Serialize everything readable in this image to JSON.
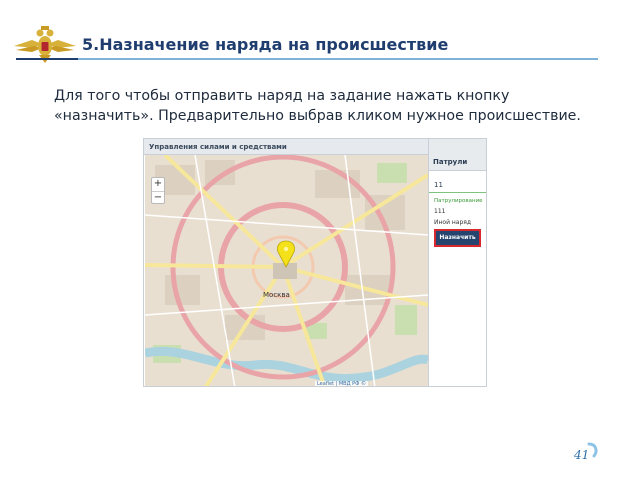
{
  "slide": {
    "title": "5.Назначение наряда на происшествие",
    "instruction_line1": "Для того чтобы отправить наряд на задание нажать кнопку",
    "instruction_line2": "«назначить». Предварительно выбрав кликом нужное происшествие.",
    "page_number": "41"
  },
  "app": {
    "header_title": "Управления силами и средствами",
    "map": {
      "zoom_in": "+",
      "zoom_out": "−",
      "city_label": "Москва",
      "attribution": "Leaflet | МВД РФ ©"
    },
    "panel": {
      "title": "Патрули",
      "patrol_id": "11",
      "status": "Патрулирование",
      "unit_number": "111",
      "task": "Иной наряд",
      "assign_button": "Назначить"
    }
  },
  "colors": {
    "title": "#1f3d6e",
    "accent_line": "#7fb2d9",
    "button_bg": "#25456e",
    "button_border": "#d9272e",
    "marker": "#f5e11a"
  },
  "icons": {
    "emblem": "double-headed-eagle-emblem-icon",
    "marker": "map-pin-icon",
    "page_arc": "page-arc-icon"
  }
}
